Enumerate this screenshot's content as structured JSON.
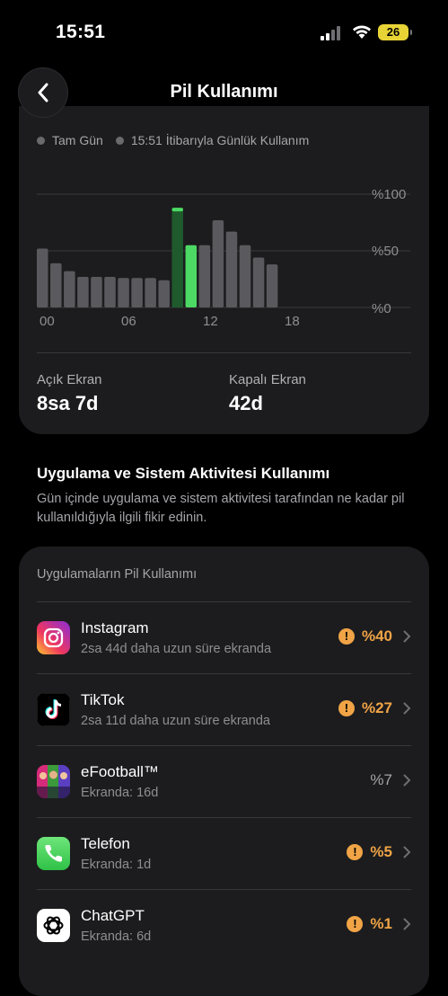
{
  "status_bar": {
    "time": "15:51",
    "battery": "26"
  },
  "header": {
    "title": "Pil Kullanımı"
  },
  "chart_card": {
    "legend": [
      "Tam Gün",
      "15:51 İtibarıyla Günlük Kullanım"
    ],
    "stats": [
      {
        "label": "Açık Ekran",
        "value": "8sa 7d"
      },
      {
        "label": "Kapalı Ekran",
        "value": "42d"
      }
    ]
  },
  "chart_data": {
    "type": "bar",
    "x_tick_labels": [
      "00",
      "06",
      "12",
      "18"
    ],
    "y_tick_labels": [
      "%100",
      "%50",
      "%0"
    ],
    "ylim": [
      0,
      100
    ],
    "values": [
      52,
      39,
      32,
      27,
      27,
      27,
      26,
      26,
      26,
      24,
      88,
      55,
      77,
      67,
      55,
      44,
      38
    ],
    "highlight_index": 10,
    "highlight_current": 55,
    "colors": {
      "bar": "#5a5a5e",
      "highlight": "#4cd964",
      "highlight_dim": "#1f5a2c",
      "grid": "#3a3a3c"
    }
  },
  "activity_section": {
    "title": "Uygulama ve Sistem Aktivitesi Kullanımı",
    "description": "Gün içinde uygulama ve sistem aktivitesi tarafından ne kadar pil kullanıldığıyla ilgili fikir edinin."
  },
  "apps_card": {
    "title": "Uygulamaların Pil Kullanımı",
    "apps": [
      {
        "name": "Instagram",
        "sub": "2sa 44d daha uzun süre ekranda",
        "pct": "%40",
        "warning": true,
        "icon": "instagram-icon"
      },
      {
        "name": "TikTok",
        "sub": "2sa 11d daha uzun süre ekranda",
        "pct": "%27",
        "warning": true,
        "icon": "tiktok-icon"
      },
      {
        "name": "eFootball™",
        "sub": "Ekranda: 16d",
        "pct": "%7",
        "warning": false,
        "icon": "efootball-icon"
      },
      {
        "name": "Telefon",
        "sub": "Ekranda: 1d",
        "pct": "%5",
        "warning": true,
        "icon": "phone-icon"
      },
      {
        "name": "ChatGPT",
        "sub": "Ekranda: 6d",
        "pct": "%1",
        "warning": true,
        "icon": "chatgpt-icon"
      }
    ],
    "warning_symbol": "!"
  }
}
